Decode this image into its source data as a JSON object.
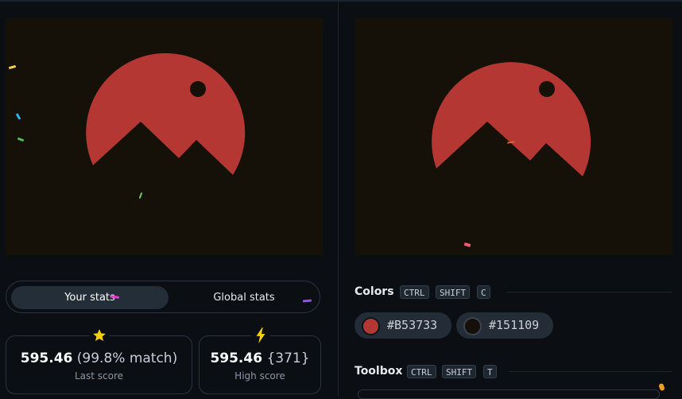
{
  "stats": {
    "tabs": [
      {
        "label": "Your stats",
        "active": true
      },
      {
        "label": "Global stats",
        "active": false
      }
    ],
    "last_score": {
      "value": "595.46",
      "detail": "(99.8% match)",
      "label": "Last score",
      "icon": "star-icon"
    },
    "high_score": {
      "value": "595.46",
      "detail": "{371}",
      "label": "High score",
      "icon": "lightning-icon"
    }
  },
  "colors": {
    "title": "Colors",
    "shortcut": [
      "CTRL",
      "SHIFT",
      "C"
    ],
    "swatches": [
      {
        "hex": "#B53733"
      },
      {
        "hex": "#151109"
      }
    ]
  },
  "toolbox": {
    "title": "Toolbox",
    "shortcut": [
      "CTRL",
      "SHIFT",
      "T"
    ]
  },
  "theme": {
    "accent_star": "#f5d000",
    "shape_color": "#B53733",
    "background_color": "#151109"
  }
}
